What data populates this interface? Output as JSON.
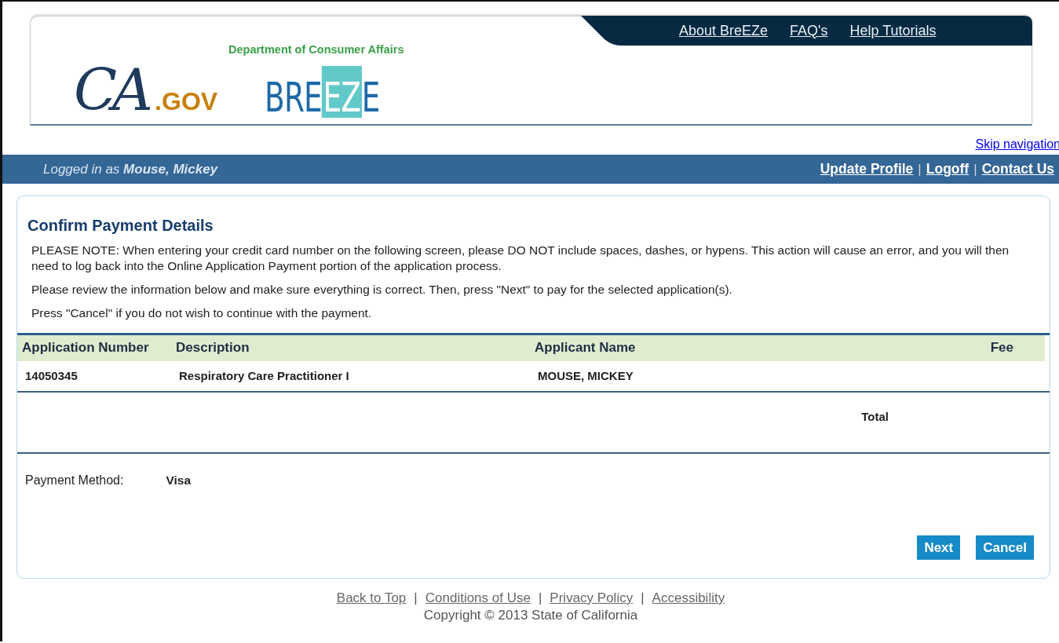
{
  "header": {
    "ca_logo": {
      "script": "CA",
      "suffix": ".GOV"
    },
    "department": "Department of Consumer Affairs",
    "breeze_logo": [
      "BRE",
      "EZ",
      "E"
    ],
    "top_links": [
      "About BreEZe",
      "FAQ's",
      "Help Tutorials"
    ]
  },
  "skip_link": "Skip navigation",
  "user_bar": {
    "prefix": "Logged in as",
    "user": "Mouse, Mickey",
    "links": [
      "Update Profile",
      "Logoff",
      "Contact Us"
    ],
    "separators": [
      "|",
      "|"
    ]
  },
  "page": {
    "title": "Confirm Payment Details",
    "notes": [
      "PLEASE NOTE: When entering your credit card number on the following screen, please DO NOT include spaces, dashes, or hypens. This action will cause an error, and you will then need to log back into the Online Application Payment portion of the application process.",
      "Please review the information below and make sure everything is correct. Then, press \"Next\" to pay for the selected application(s).",
      "Press \"Cancel\" if you do not wish to continue with the payment."
    ],
    "table": {
      "columns": [
        "Application Number",
        "Description",
        "Applicant Name",
        "Fee"
      ],
      "rows": [
        [
          "14050345",
          "Respiratory Care Practitioner I",
          "MOUSE, MICKEY"
        ]
      ],
      "total_label": "Total"
    },
    "payment": {
      "label": "Payment Method:",
      "value": "Visa"
    },
    "buttons": [
      "Next",
      "Cancel"
    ]
  },
  "footer": {
    "links": [
      "Back to Top",
      "Conditions of Use",
      "Privacy Policy",
      "Accessibility"
    ],
    "separators": [
      "|",
      "|",
      "|"
    ],
    "copyright": "Copyright © 2013 State of California"
  }
}
